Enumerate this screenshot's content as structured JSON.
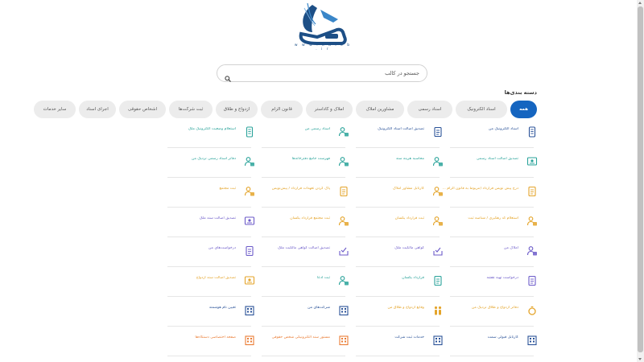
{
  "logo": {
    "url_text": "w w w . k a l e b . i r"
  },
  "search": {
    "placeholder": "جستجو در کالب"
  },
  "categories_title": "دسته بندی‌ها",
  "colors": {
    "accent": "#1565c0",
    "teal": "#2aa39a",
    "gold": "#e4a42a",
    "purple": "#6c5bc9",
    "orange": "#ea7c34",
    "navy": "#2a5298"
  },
  "tabs": [
    {
      "label": "همه",
      "active": true
    },
    {
      "label": "اسناد الکترونیک"
    },
    {
      "label": "اسناد رسمی"
    },
    {
      "label": "مشاورین املاک"
    },
    {
      "label": "املاک و کاداستر"
    },
    {
      "label": "قانون الزام"
    },
    {
      "label": "ازدواج و طلاق"
    },
    {
      "label": "ثبت شرکت‌ها"
    },
    {
      "label": "اشخاص حقوقی"
    },
    {
      "label": "اجرای اسناد"
    },
    {
      "label": "سایر خدمات"
    }
  ],
  "services": [
    [
      {
        "label": "اسناد الکترونیک من",
        "icon": "phone-doc-icon",
        "color": "navy"
      },
      {
        "label": "تصدیق اصالت اسناد الکترونیک",
        "icon": "doc-check-icon",
        "color": "navy"
      },
      {
        "label": "اسناد رسمی من",
        "icon": "person-doc-icon",
        "color": "teal"
      },
      {
        "label": "استعلام وضعیت الکترونیک ملک",
        "icon": "clipboard-icon",
        "color": "teal"
      }
    ],
    [
      {
        "label": "تصدیق اصالت اسناد رسمی",
        "icon": "doc-badge-icon",
        "color": "teal"
      },
      {
        "label": "محاسبه هزینه سند",
        "icon": "person-calc-icon",
        "color": "teal"
      },
      {
        "label": "فهرست جامع دفترخانه‌ها",
        "icon": "person-list-icon",
        "color": "teal"
      },
      {
        "label": "دفاتر اسناد رسمی نزدیک من",
        "icon": "person-pin-icon",
        "color": "teal"
      }
    ],
    [
      {
        "label": "درج پیش نویس قرارداد (مربوط به قانون الزام ...)",
        "icon": "doc-edit-icon",
        "color": "gold"
      },
      {
        "label": "کارتابل مشاور املاک",
        "icon": "person-star-icon",
        "color": "gold"
      },
      {
        "label": "پاک کردن تعهدات قرارداد / پیش‌نویس",
        "icon": "doc-pen-icon",
        "color": "gold"
      },
      {
        "label": "ثبت مجتمع",
        "icon": "person-lock-icon",
        "color": "gold"
      }
    ],
    [
      {
        "label": "استعلام کد رهگیری / شناسه ثبت",
        "icon": "person-search-icon",
        "color": "gold"
      },
      {
        "label": "ثبت قرارداد یکسان",
        "icon": "person-doc2-icon",
        "color": "gold"
      },
      {
        "label": "ثبت مجتمع قرارداد یکسان",
        "icon": "person-building-icon",
        "color": "gold"
      },
      {
        "label": "تصدیق اصالت سند ملک",
        "icon": "doc-gallery-icon",
        "color": "purple"
      }
    ],
    [
      {
        "label": "املاک من",
        "icon": "person-home-icon",
        "color": "purple"
      },
      {
        "label": "گواهی مالکیت ملک",
        "icon": "doc-tray-icon",
        "color": "purple"
      },
      {
        "label": "تصدیق اصالت گواهی مالکیت ملک",
        "icon": "doc-tray2-icon",
        "color": "purple"
      },
      {
        "label": "درخواست‌های من",
        "icon": "doc-arrow-icon",
        "color": "purple"
      }
    ],
    [
      {
        "label": "درخواست تهیه نقشه",
        "icon": "doc-list-icon",
        "color": "purple"
      },
      {
        "label": "قرارداد یکسان",
        "icon": "doc-lines-icon",
        "color": "teal"
      },
      {
        "label": "ثبت ادعا",
        "icon": "person-doc3-icon",
        "color": "teal"
      },
      {
        "label": "تصدیق اصالت سند ازدواج",
        "icon": "certificate-icon",
        "color": "gold"
      }
    ],
    [
      {
        "label": "دفاتر ازدواج و طلاق نزدیک من",
        "icon": "ring-icon",
        "color": "gold"
      },
      {
        "label": "وقایع ازدواج و طلاق من",
        "icon": "couple-icon",
        "color": "gold"
      },
      {
        "label": "شرکت‌های من",
        "icon": "building-icon",
        "color": "navy"
      },
      {
        "label": "تعیین نام هوشمند",
        "icon": "buildings-icon",
        "color": "navy"
      }
    ],
    [
      {
        "label": "کارتابل قبولی سمت",
        "icon": "building2-icon",
        "color": "navy"
      },
      {
        "label": "خدمات ثبت شرکت",
        "icon": "building3-icon",
        "color": "navy"
      },
      {
        "label": "مستور سند الکترونیکی شخص حقوقی",
        "icon": "building4-icon",
        "color": "orange"
      },
      {
        "label": "صفحه اختصاصی دستگاه‌ها",
        "icon": "building5-icon",
        "color": "orange"
      }
    ]
  ]
}
